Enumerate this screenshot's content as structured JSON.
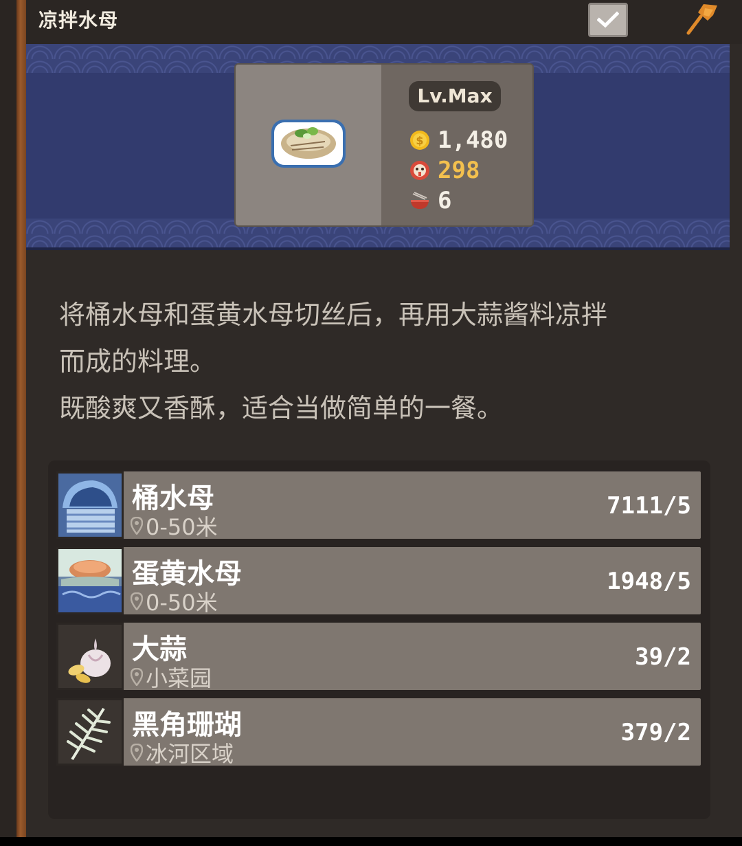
{
  "header": {
    "title": "凉拌水母"
  },
  "dish": {
    "level": "Lv.Max",
    "coin": "1,480",
    "taste": "298",
    "bowl": "6"
  },
  "description": {
    "line1": "将桶水母和蛋黄水母切丝后，再用大蒜酱料凉拌",
    "line2": "而成的料理。",
    "line3": "既酸爽又香酥，适合当做简单的一餐。"
  },
  "ingredients": [
    {
      "name": "桶水母",
      "location": "0-50米",
      "count": "7111/5"
    },
    {
      "name": "蛋黄水母",
      "location": "0-50米",
      "count": "1948/5"
    },
    {
      "name": "大蒜",
      "location": "小菜园",
      "count": "39/2"
    },
    {
      "name": "黑角珊瑚",
      "location": "冰河区域",
      "count": "379/2"
    }
  ],
  "icons": {
    "check": "check-icon",
    "pin": "pin-icon",
    "coin": "coin-icon",
    "taste": "taste-icon",
    "bowl": "bowl-icon",
    "location": "location-pin-icon"
  },
  "colors": {
    "banner": "#323b6e",
    "panel": "#2f2a27",
    "taste_value": "#f3c04e",
    "row_bg": "#7f7770"
  }
}
